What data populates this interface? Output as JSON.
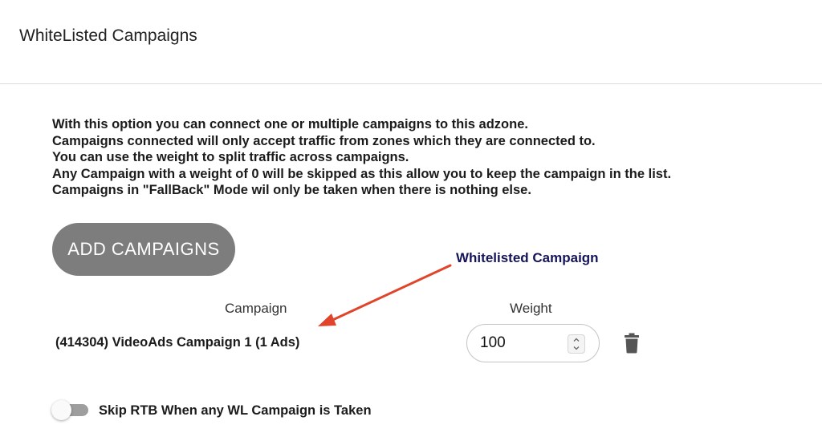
{
  "header": {
    "title": "WhiteListed Campaigns"
  },
  "description": {
    "lines": [
      "With this option you can connect one or multiple campaigns to this adzone.",
      "Campaigns connected will only accept traffic from zones which they are connected to.",
      "You can use the weight to split traffic across campaigns.",
      "Any Campaign with a weight of 0 will be skipped as this allow you to keep the campaign in the list.",
      "Campaigns in \"FallBack\" Mode wil only be taken when there is nothing else."
    ]
  },
  "actions": {
    "add_campaigns_label": "ADD CAMPAIGNS"
  },
  "annotation": {
    "label": "Whitelisted Campaign",
    "color": "#14145a",
    "arrow_color": "#e0452b"
  },
  "table": {
    "columns": {
      "campaign": "Campaign",
      "weight": "Weight"
    },
    "rows": [
      {
        "campaign": "(414304) VideoAds Campaign 1 (1 Ads)",
        "weight": "100"
      }
    ]
  },
  "options": {
    "skip_rtb_label": "Skip RTB When any WL Campaign is Taken",
    "skip_rtb_enabled": false
  },
  "icons": {
    "delete": "trash-icon",
    "spinner_up": "chevron-up-icon",
    "spinner_down": "chevron-down-icon"
  },
  "colors": {
    "button_bg": "#7d7d7d",
    "toggle_track": "#9e9e9e"
  }
}
